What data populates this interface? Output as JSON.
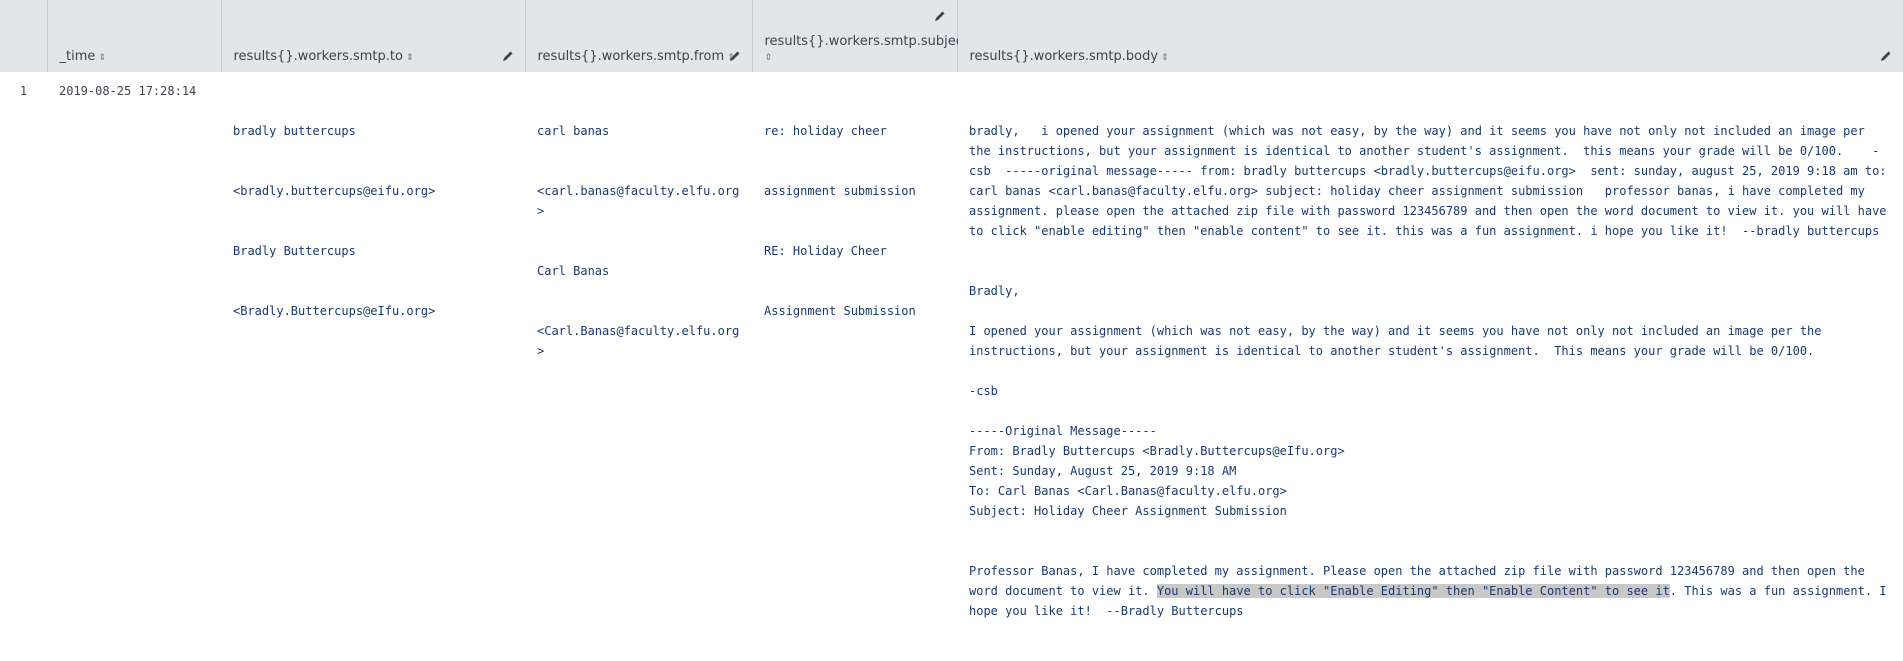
{
  "columns": [
    {
      "label": ""
    },
    {
      "label": "_time"
    },
    {
      "label": "results{}.workers.smtp.to"
    },
    {
      "label": "results{}.workers.smtp.from"
    },
    {
      "label": "results{}.workers.smtp.subject"
    },
    {
      "label": "results{}.workers.smtp.body"
    }
  ],
  "row": {
    "num": "1",
    "time": "2019-08-25 17:28:14",
    "to": [
      "bradly buttercups",
      "<bradly.buttercups@eifu.org>",
      "Bradly Buttercups",
      "<Bradly.Buttercups@eIfu.org>"
    ],
    "from": [
      "carl banas",
      "<carl.banas@faculty.elfu.org>",
      "Carl Banas",
      "<Carl.Banas@faculty.elfu.org>"
    ],
    "subject": [
      "re: holiday cheer",
      "assignment submission",
      "RE: Holiday Cheer",
      "Assignment Submission"
    ],
    "body_lower": "bradly,   i opened your assignment (which was not easy, by the way) and it seems you have not only not included an image per the instructions, but your assignment is identical to another student's assignment.  this means your grade will be 0/100.    -csb  -----original message----- from: bradly buttercups <bradly.buttercups@eifu.org>  sent: sunday, august 25, 2019 9:18 am to: carl banas <carl.banas@faculty.elfu.org> subject: holiday cheer assignment submission   professor banas, i have completed my assignment. please open the attached zip file with password 123456789 and then open the word document to view it. you will have to click \"enable editing\" then \"enable content\" to see it. this was a fun assignment. i hope you like it!  --bradly buttercups",
    "body_greeting": "Bradly,",
    "body_para": "I opened your assignment (which was not easy, by the way) and it seems you have not only not included an image per the instructions, but your assignment is identical to another student's assignment.  This means your grade will be 0/100.",
    "body_sig": "-csb",
    "orig_header": "-----Original Message-----",
    "orig_from": "From: Bradly Buttercups <Bradly.Buttercups@eIfu.org>",
    "orig_sent": "Sent: Sunday, August 25, 2019 9:18 AM",
    "orig_to": "To: Carl Banas <Carl.Banas@faculty.elfu.org>",
    "orig_subject": "Subject: Holiday Cheer Assignment Submission",
    "final_pre": "Professor Banas, I have completed my assignment. Please open the attached zip file with password 123456789 and then open the word document to view it. ",
    "final_highlight": "You will have to click \"Enable Editing\" then \"Enable Content\" to see it",
    "final_post": ". This was a fun assignment. I hope you like it!  --Bradly Buttercups"
  },
  "icons": {
    "sort": "sort-icon",
    "edit": "pencil-icon"
  },
  "colors": {
    "header_bg": "#e1e6eb",
    "cell_text": "#1a3a6b",
    "highlight": "#c8c8c8"
  }
}
